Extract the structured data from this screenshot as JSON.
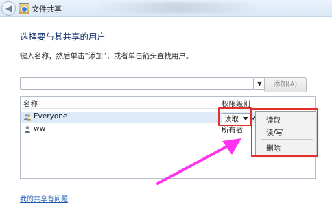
{
  "window": {
    "title": "文件共享",
    "back_icon": "back-arrow-icon",
    "app_icon": "file-share-icon"
  },
  "heading": "选择要与其共享的用户",
  "instruction": "键入名称，然后单击“添加”，或者单击箭头查找用户。",
  "name_input": {
    "value": "",
    "placeholder": ""
  },
  "add_button": {
    "label": "添加(A)",
    "enabled": false
  },
  "table": {
    "headers": {
      "name": "名称",
      "permission": "权限级别"
    },
    "rows": [
      {
        "name": "Everyone",
        "icon": "user-group-icon",
        "permission": "读取",
        "selected": true
      },
      {
        "name": "ww",
        "icon": "user-icon",
        "permission": "所有者",
        "selected": false
      }
    ]
  },
  "permission_menu": {
    "items": [
      "读取",
      "读/写",
      "删除"
    ],
    "checked_item": "读取"
  },
  "help_link": "我的共享有问题",
  "colors": {
    "annotation_red": "#e4302b",
    "arrow_magenta": "#ff33ee",
    "heading_blue": "#1e3a73",
    "link_blue": "#1e5ab3"
  }
}
